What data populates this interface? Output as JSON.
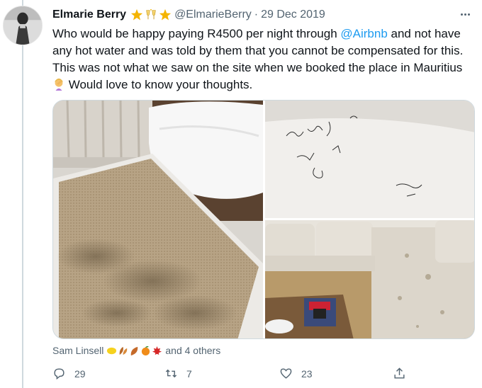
{
  "tweet": {
    "display_name": "Elmarie Berry",
    "name_emojis": [
      "star-emoji",
      "clinking-glasses-emoji",
      "star-emoji"
    ],
    "handle": "@ElmarieBerry",
    "separator": "·",
    "date": "29 Dec 2019",
    "text_part1": "Who would be happy paying R4500 per night through ",
    "mention": "@Airbnb",
    "text_part2": " and not have any hot water and was told by them that you cannot be compensated for this. This was not what we saw on the site when we booked the place in Mauritius",
    "text_emoji": "woman-facepalming-emoji",
    "text_part3": " Would love to know your thoughts.",
    "photo_count": 3
  },
  "likers": {
    "name": "Sam Linsell",
    "emojis": [
      "lemon-emoji",
      "leaves-emoji",
      "leaf-emoji",
      "orange-emoji",
      "maple-leaf-emoji"
    ],
    "others": "and 4 others"
  },
  "actions": {
    "reply_count": "29",
    "retweet_count": "7",
    "like_count": "23"
  },
  "colors": {
    "accent": "#1d9bf0",
    "muted": "#536471",
    "text": "#0f1419"
  }
}
